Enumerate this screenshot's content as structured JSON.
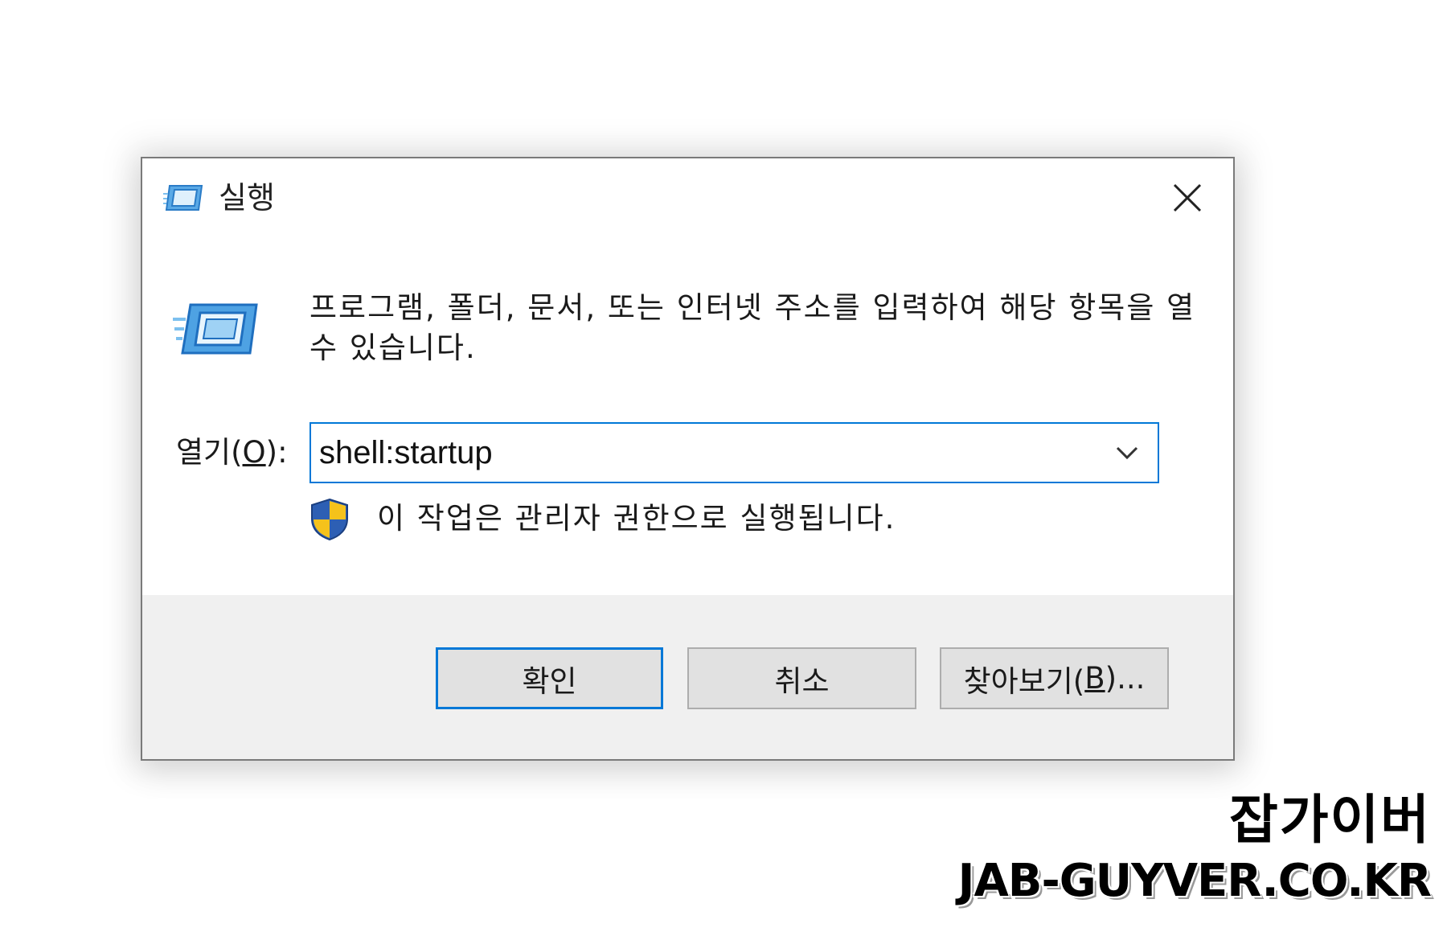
{
  "dialog": {
    "title": "실행",
    "title_icon": "run-icon",
    "close_icon": "close-icon",
    "description": "프로그램, 폴더, 문서, 또는 인터넷 주소를 입력하여 해당 항목을 열 수 있습니다.",
    "open_label_prefix": "열기(",
    "open_label_key": "O",
    "open_label_suffix": "):",
    "input_value": "shell:startup",
    "dropdown_icon": "chevron-down-icon",
    "admin_notice": "이 작업은 관리자 권한으로 실행됩니다.",
    "shield_icon": "uac-shield-icon",
    "buttons": {
      "ok": "확인",
      "cancel": "취소",
      "browse_prefix": "찾아보기(",
      "browse_key": "B",
      "browse_suffix": ")..."
    }
  },
  "watermark": {
    "line1": "잡가이버",
    "line2": "JAB-GUYVER.CO.KR"
  },
  "colors": {
    "accent": "#0078d7",
    "footer_bg": "#f0f0f0",
    "button_bg": "#e1e1e1",
    "border": "#7a7a7a"
  }
}
